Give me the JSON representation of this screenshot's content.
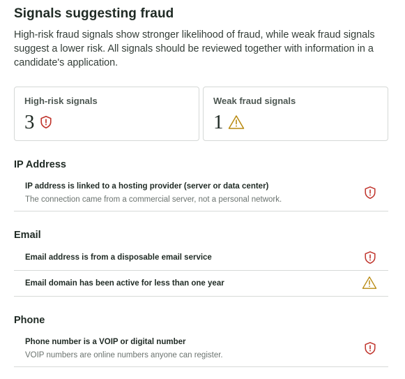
{
  "page": {
    "title": "Signals suggesting fraud",
    "intro": "High-risk fraud signals show stronger likelihood of fraud, while weak fraud signals suggest a lower risk. All signals should be reviewed together with information in a candidate's application."
  },
  "summary": {
    "high_risk": {
      "label": "High-risk signals",
      "count": "3",
      "icon": "shield-alert-icon"
    },
    "weak": {
      "label": "Weak fraud signals",
      "count": "1",
      "icon": "warning-triangle-icon"
    }
  },
  "sections": {
    "ip": {
      "title": "IP Address",
      "signals": [
        {
          "primary": "IP address is linked to a hosting provider (server or data center)",
          "secondary": "The connection came from a commercial server, not a personal network.",
          "severity": "high",
          "icon": "shield-alert-icon"
        }
      ]
    },
    "email": {
      "title": "Email",
      "signals": [
        {
          "primary": "Email address is from a disposable email service",
          "severity": "high",
          "icon": "shield-alert-icon"
        },
        {
          "primary": "Email domain has been active for less than one year",
          "severity": "weak",
          "icon": "warning-triangle-icon"
        }
      ]
    },
    "phone": {
      "title": "Phone",
      "signals": [
        {
          "primary": "Phone number is a VOIP or digital number",
          "secondary": "VOIP numbers are online numbers anyone can register.",
          "severity": "high",
          "icon": "shield-alert-icon"
        }
      ]
    }
  },
  "colors": {
    "high_risk": "#c0342c",
    "weak": "#b8890f",
    "divider": "#d7dad8"
  }
}
